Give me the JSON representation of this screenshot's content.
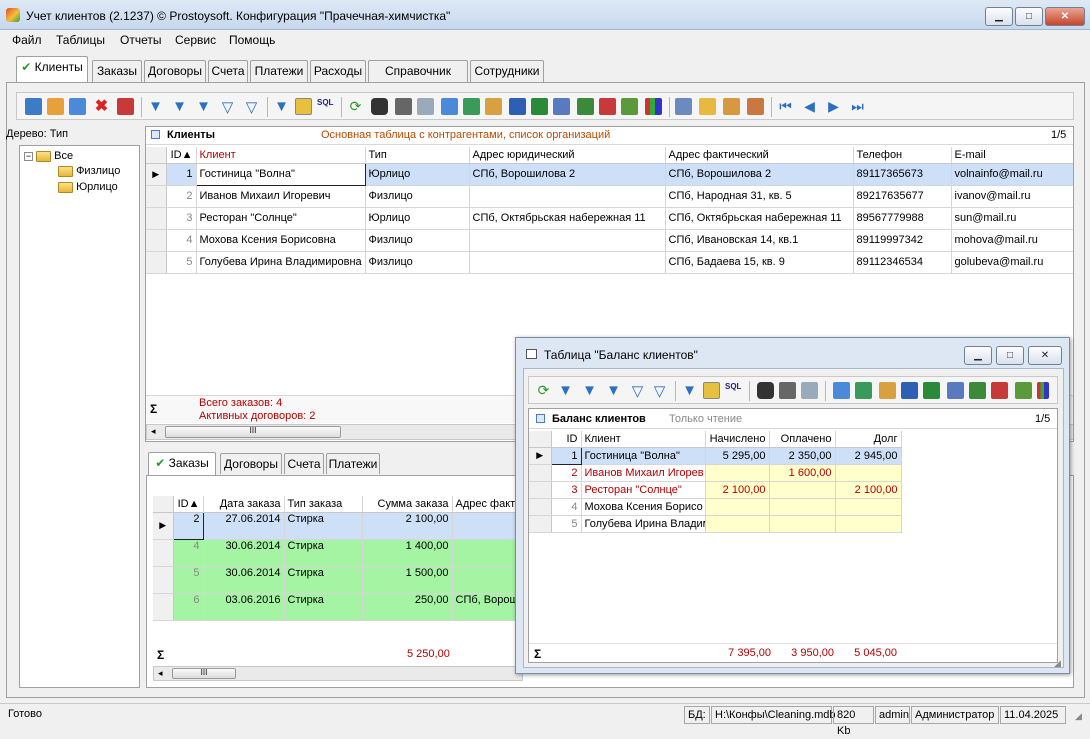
{
  "app": {
    "title": "Учет клиентов (2.1237) © Prostoysoft. Конфигурация \"Прачечная-химчистка\""
  },
  "menu": [
    "Файл",
    "Таблицы",
    "Отчеты",
    "Сервис",
    "Помощь"
  ],
  "tabs": [
    "Клиенты",
    "Заказы",
    "Договоры",
    "Счета",
    "Платежи",
    "Расходы",
    "Справочник услуг",
    "Сотрудники"
  ],
  "tree": {
    "header": "Дерево: Тип",
    "root": "Все",
    "children": [
      "Физлицо",
      "Юрлицо"
    ]
  },
  "clients": {
    "title": "Клиенты",
    "desc": "Основная таблица с контрагентами, список организаций",
    "count": "1/5",
    "columns": [
      "ID",
      "Клиент",
      "Тип",
      "Адрес юридический",
      "Адрес фактический",
      "Телефон",
      "E-mail"
    ],
    "rows": [
      [
        "1",
        "Гостиница \"Волна\"",
        "Юрлицо",
        "СПб, Ворошилова 2",
        "СПб, Ворошилова 2",
        "89117365673",
        "volnainfo@mail.ru"
      ],
      [
        "2",
        "Иванов Михаил Игоревич",
        "Физлицо",
        "",
        "СПб, Народная 31, кв. 5",
        "89217635677",
        "ivanov@mail.ru"
      ],
      [
        "3",
        "Ресторан \"Солнце\"",
        "Юрлицо",
        "СПб, Октябрьская набережная 11",
        "СПб, Октябрьская набережная 11",
        "89567779988",
        "sun@mail.ru"
      ],
      [
        "4",
        "Мохова Ксения Борисовна",
        "Физлицо",
        "",
        "СПб, Ивановская 14, кв.1",
        "89119997342",
        "mohova@mail.ru"
      ],
      [
        "5",
        "Голубева Ирина Владимировна",
        "Физлицо",
        "",
        "СПб, Бадаева 15, кв. 9",
        "89112346534",
        "golubeva@mail.ru"
      ]
    ],
    "summary": [
      "Всего заказов: 4",
      "Активных договоров: 2"
    ],
    "sigma": "Σ"
  },
  "subtabs": [
    "Заказы",
    "Договоры",
    "Счета",
    "Платежи"
  ],
  "orders": {
    "columns": [
      "ID",
      "Дата заказа",
      "Тип заказа",
      "Сумма заказа",
      "Адрес факти"
    ],
    "rows": [
      [
        "2",
        "27.06.2014",
        "Стирка",
        "2 100,00",
        ""
      ],
      [
        "4",
        "30.06.2014",
        "Стирка",
        "1 400,00",
        ""
      ],
      [
        "5",
        "30.06.2014",
        "Стирка",
        "1 500,00",
        ""
      ],
      [
        "6",
        "03.06.2016",
        "Стирка",
        "250,00",
        "СПб, Ворош"
      ]
    ],
    "total": "5 250,00"
  },
  "balance": {
    "window_title": "Таблица \"Баланс клиентов\"",
    "title": "Баланс клиентов",
    "mode": "Только чтение",
    "count": "1/5",
    "columns": [
      "ID",
      "Клиент",
      "Начислено",
      "Оплачено",
      "Долг"
    ],
    "rows": [
      [
        "1",
        "Гостиница \"Волна\"",
        "5 295,00",
        "2 350,00",
        "2 945,00"
      ],
      [
        "2",
        "Иванов Михаил Игорев",
        "",
        "1 600,00",
        ""
      ],
      [
        "3",
        "Ресторан \"Солнце\"",
        "2 100,00",
        "",
        "2 100,00"
      ],
      [
        "4",
        "Мохова Ксения Борисо",
        "",
        "",
        ""
      ],
      [
        "5",
        "Голубева Ирина Владим",
        "",
        "",
        ""
      ]
    ],
    "totals": [
      "7 395,00",
      "3 950,00",
      "5 045,00"
    ]
  },
  "status": {
    "ready": "Готово",
    "db_label": "БД:",
    "db_path": "H:\\Конфы\\Cleaning.mdb",
    "size": "820 Kb",
    "user": "admin",
    "role": "Администратор",
    "date": "11.04.2025"
  }
}
